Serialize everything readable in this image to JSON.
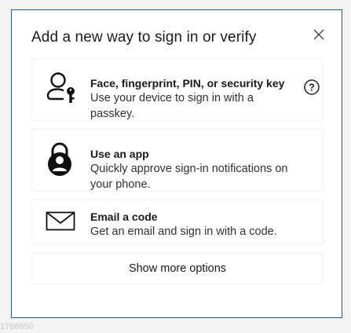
{
  "dialog": {
    "title": "Add a new way to sign in or verify",
    "close_icon": "close-icon"
  },
  "options": [
    {
      "icon": "passkey-person-icon",
      "title": "Face, fingerprint, PIN, or security key",
      "description": "Use your device to sign in with a passkey.",
      "help_icon": "help-circle-icon"
    },
    {
      "icon": "authenticator-app-icon",
      "title": "Use an app",
      "description": "Quickly approve sign-in notifications on your phone."
    },
    {
      "icon": "envelope-icon",
      "title": "Email a code",
      "description": "Get an email and sign in with a code."
    }
  ],
  "show_more_label": "Show more options",
  "background_fragment": "1766850",
  "colors": {
    "dialog_border": "#1f5a8a",
    "background": "#f3f3f3",
    "text": "#1b1b1b"
  }
}
